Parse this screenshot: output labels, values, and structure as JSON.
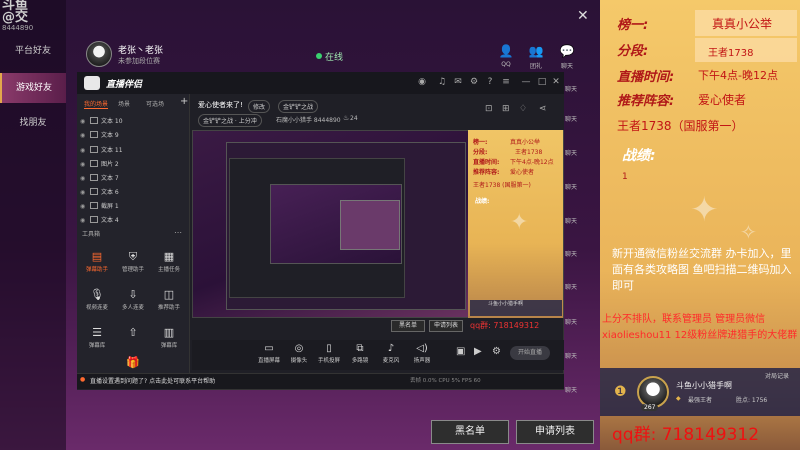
{
  "outer": {
    "corner_logo": "斗鱼\n@交",
    "corner_id": "8444890",
    "sidebar": [
      {
        "label": "平台好友",
        "active": false
      },
      {
        "label": "游戏好友",
        "active": true
      },
      {
        "label": "找朋友",
        "active": false
      }
    ],
    "profile": {
      "name": "老张丶老张",
      "sub": "未参加段位赛",
      "status": "在线"
    },
    "tools": [
      {
        "icon": "person-icon",
        "label": "QQ"
      },
      {
        "icon": "people-icon",
        "label": "团礼"
      },
      {
        "icon": "chat-icon",
        "label": "聊天"
      }
    ],
    "right_chats": [
      "聊天",
      "聊天",
      "聊天",
      "聊天",
      "聊天",
      "聊天",
      "聊天",
      "聊天",
      "聊天",
      "聊天",
      "聊天"
    ],
    "buttons": {
      "blacklist": "黑名单",
      "apply_list": "申请列表"
    }
  },
  "app": {
    "title": "直播伴侣",
    "badge": "",
    "scene_tabs": [
      "我的场景",
      "场景",
      "可选场"
    ],
    "layers": [
      "文本 10",
      "文本 9",
      "文本 11",
      "图片 2",
      "文本 7",
      "文本 6",
      "截屏 1",
      "文本 4"
    ],
    "tools_title": "工具箱",
    "tool_items": [
      {
        "label": "弹幕助手",
        "hot": true
      },
      {
        "label": "管理助手",
        "hot": false
      },
      {
        "label": "主播任务",
        "hot": false
      },
      {
        "label": "视频连麦",
        "hot": false
      },
      {
        "label": "多人连麦",
        "hot": false
      },
      {
        "label": "推荐助手",
        "hot": false
      },
      {
        "label": "弹幕库",
        "hot": false
      },
      {
        "label": "",
        "hot": false
      },
      {
        "label": "弹幕库",
        "hot": false
      }
    ],
    "announce": "爱心使者来了!",
    "chips": [
      "修改",
      "金铲铲之战",
      "金铲铲之战 · 上分冲"
    ],
    "room_info": "石魔小小猎手  8444890",
    "viewers": "24",
    "mini": {
      "rank_label": "榜一:",
      "seg_label": "分段:",
      "time_label": "直播时间:",
      "rec_label": "推荐阵容:",
      "rank_val": "真真小公举",
      "seg_val": "王者1738",
      "time_val": "下午4点-晚12点",
      "rec_val": "爱心使者",
      "rank_line": "王者1738 (国服第一)",
      "battle": "战绩:",
      "qq": "qq群: 718149312",
      "streamer": "斗鱼小小猎手啊"
    },
    "mini_buttons": {
      "blacklist": "黑名单",
      "apply": "申请列表"
    },
    "bottom_items": [
      {
        "icon": "monitor-icon",
        "label": "直播屏幕"
      },
      {
        "icon": "camera-icon",
        "label": "摄像头"
      },
      {
        "icon": "phone-icon",
        "label": "手机投屏"
      },
      {
        "icon": "window-icon",
        "label": "多路镜"
      },
      {
        "icon": "mic-icon",
        "label": "麦克风"
      },
      {
        "icon": "speaker-icon",
        "label": "扬声器"
      }
    ],
    "start_live": "开始直播",
    "status_msg": "直播设置遇到问题了? 点击此处可联系平台帮助",
    "status_stats": "丢帧 0.0%  CPU 5%  FPS 60"
  },
  "panel": {
    "rank_label": "榜一:",
    "rank_val": "真真小公举",
    "seg_label": "分段:",
    "seg_val": "王者1738",
    "time_label": "直播时间:",
    "time_val": "下午4点-晚12点",
    "rec_label": "推荐阵容:",
    "rec_val": "爱心使者",
    "rank_line": "王者1738（国服第一）",
    "battle_label": "战绩:",
    "battle_val": "1",
    "notice": "新开通微信粉丝交流群 办卡加入，里面有各类攻略图 鱼吧扫描二维码加入即可",
    "rules": "上分不排队，联系管理员 管理员微信xiaolieshou11 12级粉丝牌进猎手的大佬群",
    "streamer_name": "斗鱼小小猎手啊",
    "streamer_title": "最强王者",
    "streamer_win": "胜点: 1756",
    "streamer_time": "对局记录",
    "streamer_level": "267",
    "qq": "qq群: 718149312"
  },
  "colors": {
    "accent": "#ff6a2f",
    "panel_bg": "#eab45a",
    "red": "#c21414",
    "online": "#3ad16f"
  }
}
